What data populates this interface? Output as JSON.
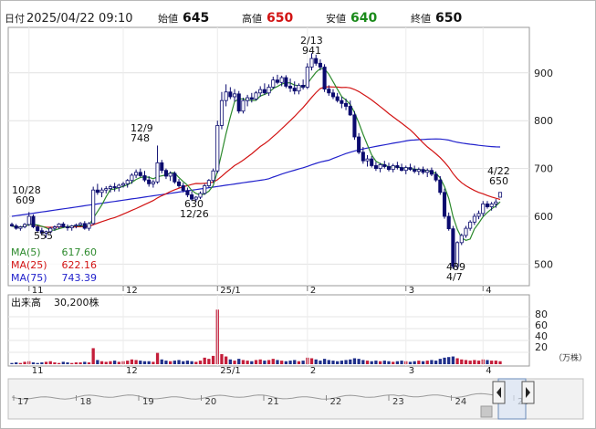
{
  "header": {
    "date_label": "日付",
    "datetime": "2025/04/22 09:10",
    "open_label": "始値",
    "open_value": "645",
    "high_label": "高値",
    "high_value": "650",
    "low_label": "安値",
    "low_value": "640",
    "close_label": "終値",
    "close_value": "650"
  },
  "colors": {
    "up": "#1a8a1a",
    "down": "#d21414",
    "ma5": "#2d8a2d",
    "ma25": "#d21414",
    "ma75": "#2222cc",
    "candle": "#0a0a6e",
    "volume": "#c41e3a"
  },
  "legend": [
    {
      "label": "MA(5)",
      "value": "617.60",
      "color": "#2d8a2d"
    },
    {
      "label": "MA(25)",
      "value": "622.16",
      "color": "#d21414"
    },
    {
      "label": "MA(75)",
      "value": "743.39",
      "color": "#2222cc"
    }
  ],
  "annotations": [
    {
      "date": "10/28",
      "value": "609"
    },
    {
      "value": "555"
    },
    {
      "date": "12/9",
      "value": "748"
    },
    {
      "value": "630",
      "date": "12/26"
    },
    {
      "date": "2/13",
      "value": "941"
    },
    {
      "value": "489",
      "date": "4/7"
    },
    {
      "date": "4/22",
      "value": "650"
    }
  ],
  "volume_panel": {
    "title": "出来高",
    "value": "30,200株",
    "unit": "（万株）",
    "ticks": [
      "80",
      "60",
      "40",
      "20"
    ]
  },
  "navigator": {
    "ticks": [
      "17",
      "18",
      "19",
      "20",
      "21",
      "22",
      "23",
      "24",
      "25"
    ]
  },
  "chart_data": {
    "type": "candlestick",
    "x_month_labels": [
      "11",
      "12",
      "25/1",
      "2",
      "3",
      "4"
    ],
    "y_ticks": [
      500,
      600,
      700,
      800,
      900
    ],
    "ylim": [
      455,
      995
    ],
    "candles": [
      [
        583,
        587,
        578,
        580
      ],
      [
        580,
        584,
        572,
        575
      ],
      [
        575,
        580,
        570,
        578
      ],
      [
        578,
        586,
        575,
        583
      ],
      [
        583,
        609,
        580,
        600
      ],
      [
        600,
        604,
        575,
        578
      ],
      [
        578,
        582,
        566,
        570
      ],
      [
        570,
        576,
        560,
        565
      ],
      [
        565,
        570,
        555,
        568
      ],
      [
        568,
        578,
        563,
        575
      ],
      [
        575,
        581,
        570,
        578
      ],
      [
        578,
        586,
        574,
        584
      ],
      [
        584,
        588,
        576,
        578
      ],
      [
        578,
        583,
        570,
        576
      ],
      [
        576,
        582,
        570,
        580
      ],
      [
        580,
        585,
        575,
        582
      ],
      [
        582,
        588,
        578,
        585
      ],
      [
        585,
        590,
        572,
        575
      ],
      [
        575,
        588,
        570,
        585
      ],
      [
        585,
        662,
        582,
        655
      ],
      [
        655,
        668,
        645,
        650
      ],
      [
        650,
        660,
        640,
        655
      ],
      [
        655,
        663,
        648,
        658
      ],
      [
        658,
        666,
        650,
        662
      ],
      [
        662,
        670,
        652,
        660
      ],
      [
        660,
        668,
        652,
        665
      ],
      [
        665,
        672,
        660,
        668
      ],
      [
        668,
        678,
        660,
        675
      ],
      [
        675,
        690,
        668,
        686
      ],
      [
        686,
        698,
        680,
        692
      ],
      [
        692,
        700,
        682,
        685
      ],
      [
        685,
        695,
        672,
        676
      ],
      [
        676,
        684,
        662,
        668
      ],
      [
        668,
        676,
        660,
        672
      ],
      [
        672,
        748,
        668,
        712
      ],
      [
        712,
        718,
        690,
        696
      ],
      [
        696,
        700,
        678,
        684
      ],
      [
        684,
        694,
        674,
        690
      ],
      [
        690,
        694,
        668,
        672
      ],
      [
        672,
        678,
        660,
        664
      ],
      [
        664,
        670,
        650,
        654
      ],
      [
        654,
        660,
        640,
        645
      ],
      [
        645,
        652,
        632,
        636
      ],
      [
        636,
        642,
        630,
        640
      ],
      [
        640,
        652,
        636,
        648
      ],
      [
        648,
        668,
        645,
        664
      ],
      [
        664,
        678,
        660,
        675
      ],
      [
        675,
        700,
        670,
        695
      ],
      [
        695,
        800,
        690,
        790
      ],
      [
        790,
        860,
        782,
        842
      ],
      [
        842,
        876,
        830,
        860
      ],
      [
        860,
        870,
        845,
        850
      ],
      [
        850,
        866,
        840,
        856
      ],
      [
        856,
        862,
        815,
        820
      ],
      [
        820,
        848,
        815,
        842
      ],
      [
        842,
        854,
        830,
        848
      ],
      [
        848,
        858,
        838,
        845
      ],
      [
        845,
        862,
        842,
        858
      ],
      [
        858,
        872,
        850,
        865
      ],
      [
        865,
        878,
        854,
        858
      ],
      [
        858,
        876,
        852,
        870
      ],
      [
        870,
        892,
        866,
        885
      ],
      [
        885,
        896,
        876,
        880
      ],
      [
        880,
        894,
        872,
        890
      ],
      [
        890,
        895,
        868,
        872
      ],
      [
        872,
        888,
        860,
        868
      ],
      [
        868,
        882,
        855,
        862
      ],
      [
        862,
        878,
        855,
        874
      ],
      [
        874,
        886,
        865,
        870
      ],
      [
        870,
        920,
        866,
        912
      ],
      [
        912,
        941,
        905,
        930
      ],
      [
        930,
        938,
        915,
        920
      ],
      [
        920,
        928,
        905,
        912
      ],
      [
        912,
        918,
        860,
        866
      ],
      [
        866,
        874,
        852,
        858
      ],
      [
        858,
        866,
        845,
        850
      ],
      [
        850,
        858,
        838,
        842
      ],
      [
        842,
        850,
        826,
        836
      ],
      [
        836,
        846,
        822,
        830
      ],
      [
        830,
        842,
        810,
        812
      ],
      [
        812,
        820,
        760,
        766
      ],
      [
        766,
        774,
        730,
        734
      ],
      [
        734,
        745,
        710,
        716
      ],
      [
        716,
        728,
        704,
        720
      ],
      [
        720,
        726,
        702,
        706
      ],
      [
        706,
        714,
        695,
        700
      ],
      [
        700,
        712,
        692,
        708
      ],
      [
        708,
        716,
        700,
        704
      ],
      [
        704,
        712,
        694,
        698
      ],
      [
        698,
        710,
        692,
        706
      ],
      [
        706,
        714,
        698,
        702
      ],
      [
        702,
        710,
        694,
        696
      ],
      [
        696,
        706,
        688,
        702
      ],
      [
        702,
        710,
        695,
        698
      ],
      [
        698,
        706,
        690,
        694
      ],
      [
        694,
        702,
        686,
        698
      ],
      [
        698,
        704,
        688,
        692
      ],
      [
        692,
        700,
        682,
        696
      ],
      [
        696,
        702,
        684,
        688
      ],
      [
        688,
        694,
        672,
        676
      ],
      [
        676,
        684,
        645,
        650
      ],
      [
        650,
        658,
        595,
        600
      ],
      [
        600,
        608,
        570,
        574
      ],
      [
        574,
        580,
        490,
        495
      ],
      [
        495,
        548,
        489,
        545
      ],
      [
        545,
        564,
        540,
        560
      ],
      [
        560,
        580,
        555,
        575
      ],
      [
        575,
        592,
        570,
        588
      ],
      [
        588,
        606,
        582,
        600
      ],
      [
        600,
        612,
        594,
        606
      ],
      [
        606,
        632,
        600,
        626
      ],
      [
        626,
        632,
        616,
        620
      ],
      [
        620,
        630,
        612,
        626
      ],
      [
        626,
        636,
        618,
        630
      ],
      [
        640,
        650,
        640,
        650
      ]
    ],
    "volume": [
      2,
      3,
      2,
      4,
      5,
      3,
      2,
      3,
      4,
      5,
      3,
      2,
      4,
      3,
      2,
      3,
      3,
      4,
      3,
      27,
      7,
      5,
      4,
      5,
      6,
      4,
      5,
      6,
      8,
      7,
      6,
      5,
      5,
      4,
      19,
      8,
      6,
      5,
      6,
      7,
      5,
      6,
      5,
      4,
      6,
      11,
      9,
      14,
      92,
      17,
      13,
      8,
      6,
      9,
      7,
      6,
      5,
      7,
      8,
      6,
      7,
      9,
      7,
      6,
      5,
      6,
      7,
      5,
      6,
      11,
      10,
      8,
      6,
      9,
      7,
      6,
      5,
      6,
      7,
      8,
      10,
      9,
      7,
      6,
      5,
      6,
      5,
      6,
      5,
      4,
      5,
      6,
      5,
      4,
      5,
      6,
      5,
      6,
      7,
      6,
      9,
      11,
      12,
      13,
      10,
      8,
      7,
      6,
      7,
      6,
      8,
      7,
      6,
      6,
      5
    ]
  }
}
